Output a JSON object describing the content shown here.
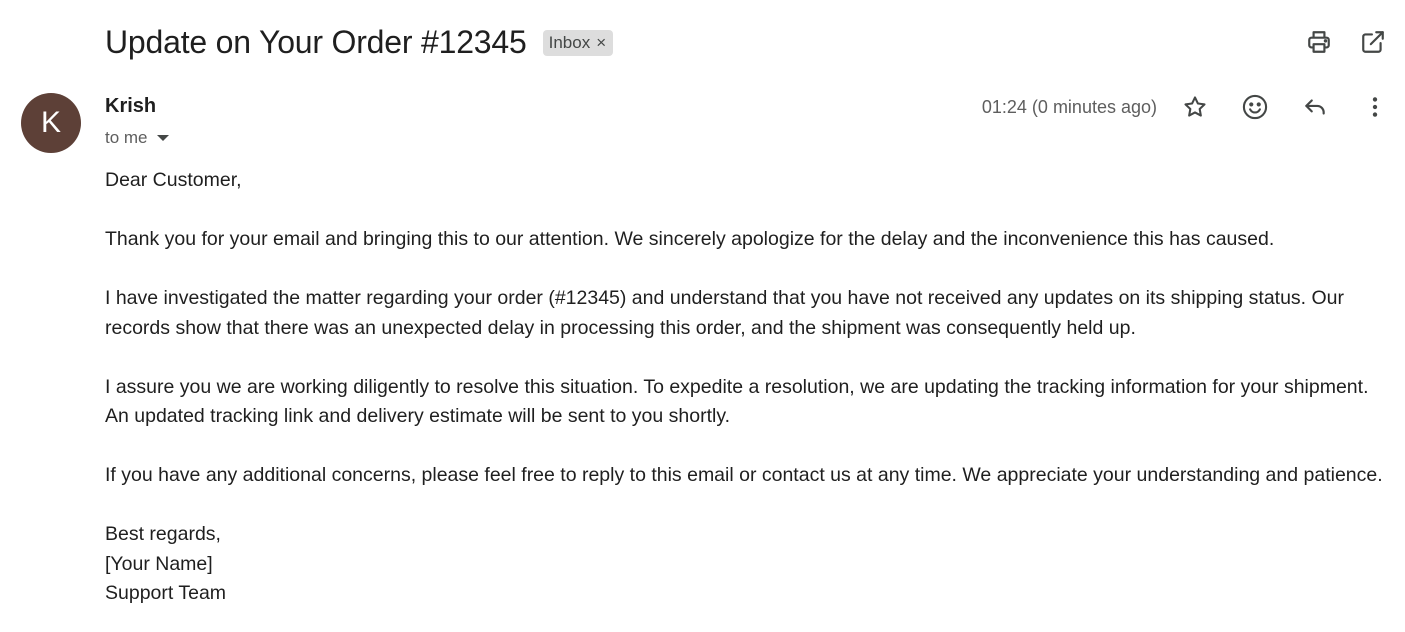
{
  "email": {
    "subject": "Update on Your Order #12345",
    "label": "Inbox",
    "label_remove": "×",
    "sender_name": "Krish",
    "avatar_letter": "K",
    "recipient": "to me",
    "timestamp": "01:24 (0 minutes ago)"
  },
  "body": {
    "greeting": "Dear Customer,",
    "p1": "Thank you for your email and bringing this to our attention. We sincerely apologize for the delay and the inconvenience this has caused.",
    "p2_l1": "I have investigated the matter regarding your order (#12345) and understand that you have not received any updates on its shipping status. Our",
    "p2_l2": "records show that there was an unexpected delay in processing this order, and the shipment was consequently held up.",
    "p3_l1": "I assure you we are working diligently to resolve this situation. To expedite a resolution, we are updating the tracking information for your shipment.",
    "p3_l2": "An updated tracking link and delivery estimate will be sent to you shortly.",
    "p4": "If you have any additional concerns, please feel free to reply to this email or contact us at any time. We appreciate your understanding and patience.",
    "signoff": "Best regards,",
    "name": "[Your Name]",
    "team": "Support Team"
  },
  "icons": {
    "print": "print-icon",
    "open_new_window": "open-in-new-window-icon",
    "star": "star-icon",
    "emoji": "emoji-reaction-icon",
    "reply": "reply-icon",
    "more": "more-vertical-icon"
  },
  "colors": {
    "avatar_bg": "#5d4037",
    "chip_bg": "#dddddd",
    "text": "#1f1f1f",
    "muted": "#5e5e5e"
  }
}
